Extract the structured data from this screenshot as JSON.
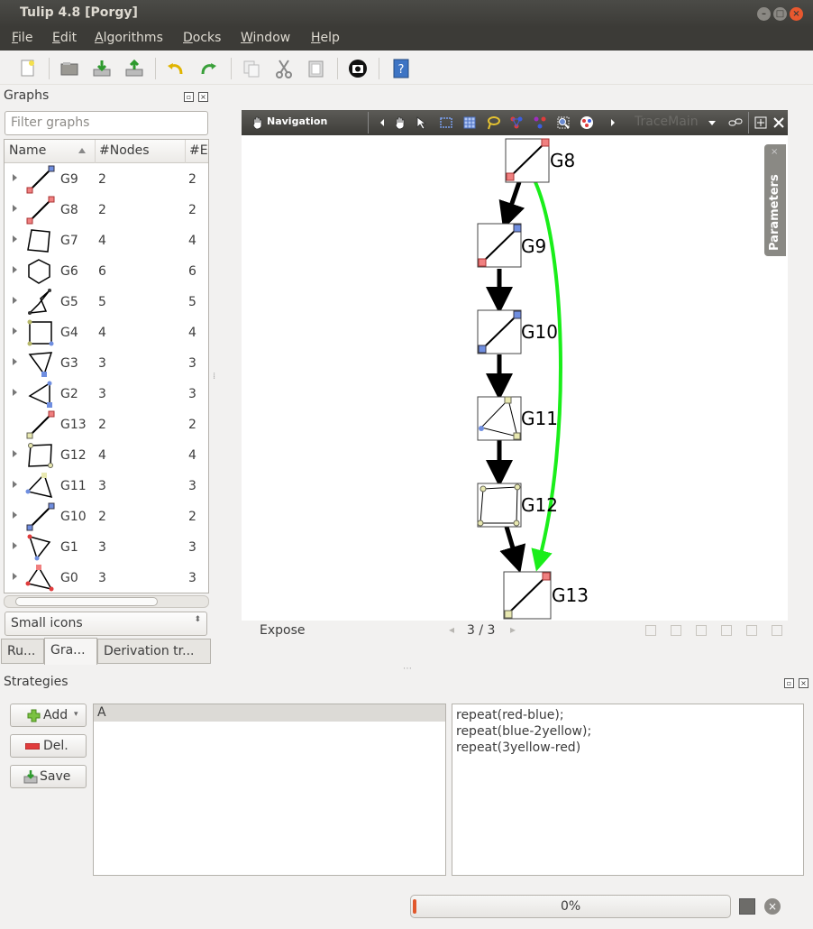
{
  "window": {
    "title": "Tulip 4.8 [Porgy]",
    "min": "–",
    "max": "□",
    "close": "×"
  },
  "menu": [
    {
      "label": "File",
      "mn": "F",
      "rest": "ile"
    },
    {
      "label": "Edit",
      "mn": "E",
      "rest": "dit"
    },
    {
      "label": "Algorithms",
      "mn": "A",
      "rest": "lgorithms"
    },
    {
      "label": "Docks",
      "mn": "D",
      "rest": "ocks"
    },
    {
      "label": "Window",
      "mn": "W",
      "rest": "indow"
    },
    {
      "label": "Help",
      "mn": "H",
      "rest": "elp"
    }
  ],
  "toolbar": [
    "new-file-icon",
    "open-folder-icon",
    "import-icon",
    "export-icon",
    "undo-icon",
    "redo-icon",
    "copy-icon",
    "cut-icon",
    "paste-icon",
    "screenshot-icon",
    "help-icon"
  ],
  "graphs_panel": {
    "title": "Graphs",
    "filter_placeholder": "Filter graphs",
    "columns": [
      "Name",
      "#Nodes",
      "#E"
    ],
    "rows": [
      {
        "name": "G9",
        "nodes": "2",
        "edges": "2"
      },
      {
        "name": "G8",
        "nodes": "2",
        "edges": "2"
      },
      {
        "name": "G7",
        "nodes": "4",
        "edges": "4"
      },
      {
        "name": "G6",
        "nodes": "6",
        "edges": "6"
      },
      {
        "name": "G5",
        "nodes": "5",
        "edges": "5"
      },
      {
        "name": "G4",
        "nodes": "4",
        "edges": "4"
      },
      {
        "name": "G3",
        "nodes": "3",
        "edges": "3"
      },
      {
        "name": "G2",
        "nodes": "3",
        "edges": "3"
      },
      {
        "name": "G13",
        "nodes": "2",
        "edges": "2"
      },
      {
        "name": "G12",
        "nodes": "4",
        "edges": "4"
      },
      {
        "name": "G11",
        "nodes": "3",
        "edges": "3"
      },
      {
        "name": "G10",
        "nodes": "2",
        "edges": "2"
      },
      {
        "name": "G1",
        "nodes": "3",
        "edges": "3"
      },
      {
        "name": "G0",
        "nodes": "3",
        "edges": "3"
      }
    ],
    "icon_size": "Small icons",
    "tabs": [
      "Ru...",
      "Gra...",
      "Derivation tr..."
    ]
  },
  "view": {
    "mode": "Navigation",
    "trace": "TraceMain",
    "parameters": "Parameters",
    "expose": "Expose",
    "page": "3 / 3",
    "nodes": [
      "G8",
      "G9",
      "G10",
      "G11",
      "G12",
      "G13"
    ]
  },
  "strategies": {
    "title": "Strategies",
    "add": "Add",
    "del": "Del.",
    "save": "Save",
    "selected": "A",
    "code": [
      "repeat(red-blue);",
      "repeat(blue-2yellow);",
      "repeat(3yellow-red)"
    ]
  },
  "progress": {
    "percent": "0%",
    "fraction": 0.0
  },
  "colors": {
    "accent": "#e1582c",
    "edge_green": "#1aee1a",
    "node_red": "#f08080",
    "node_blue": "#6f8ee0",
    "node_yellow": "#e8e8b0"
  }
}
